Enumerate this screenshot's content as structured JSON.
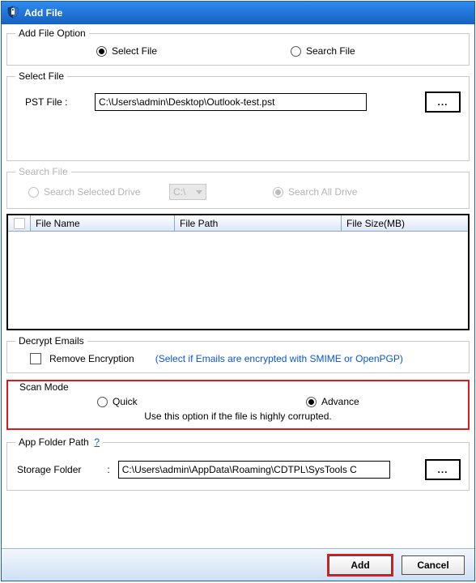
{
  "window": {
    "title": "Add File"
  },
  "addFileOption": {
    "legend": "Add File Option",
    "selectFile": "Select File",
    "searchFile": "Search File"
  },
  "selectFile": {
    "legend": "Select File",
    "label": "PST File :",
    "value": "C:\\Users\\admin\\Desktop\\Outlook-test.pst",
    "browse": "..."
  },
  "searchFile": {
    "legend": "Search File",
    "searchSelected": "Search Selected Drive",
    "driveValue": "C:\\",
    "searchAll": "Search All Drive"
  },
  "table": {
    "columns": {
      "fileName": "File Name",
      "filePath": "File Path",
      "fileSize": "File Size(MB)"
    }
  },
  "decrypt": {
    "legend": "Decrypt Emails",
    "removeLabel": "Remove Encryption",
    "hint": "(Select if Emails are encrypted with SMIME or OpenPGP)"
  },
  "scanMode": {
    "legend": "Scan Mode",
    "quick": "Quick",
    "advance": "Advance",
    "hint": "Use this option if the file is highly corrupted."
  },
  "appFolder": {
    "legend": "App Folder Path",
    "help": "?",
    "label": "Storage Folder",
    "colon": ":",
    "value": "C:\\Users\\admin\\AppData\\Roaming\\CDTPL\\SysTools C",
    "browse": "..."
  },
  "footer": {
    "add": "Add",
    "cancel": "Cancel"
  }
}
